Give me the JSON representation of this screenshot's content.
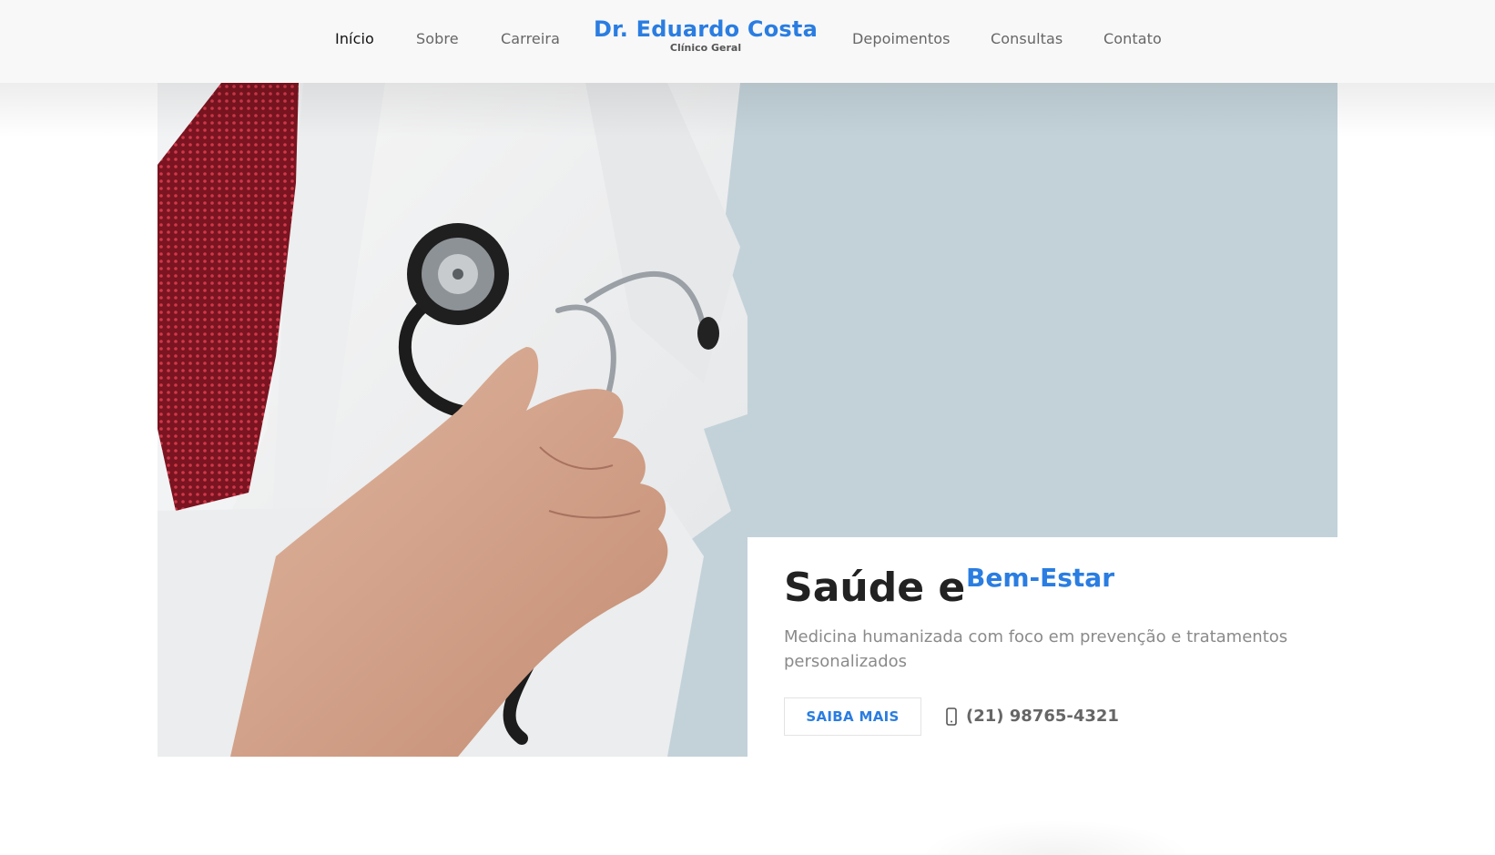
{
  "nav": {
    "items": [
      {
        "label": "Início",
        "active": true
      },
      {
        "label": "Sobre",
        "active": false
      },
      {
        "label": "Carreira",
        "active": false
      },
      {
        "label": "Depoimentos",
        "active": false
      },
      {
        "label": "Consultas",
        "active": false
      },
      {
        "label": "Contato",
        "active": false
      }
    ]
  },
  "logo": {
    "name": "Dr. Eduardo Costa",
    "subtitle": "Clínico Geral"
  },
  "hero": {
    "headline": "Saúde e",
    "headline_accent": "Bem-Estar",
    "subtitle": "Medicina humanizada com foco em prevenção e tratamentos personalizados",
    "cta_label": "SAIBA MAIS",
    "phone_icon": "mobile-phone-icon",
    "phone": "(21) 98765-4321"
  },
  "colors": {
    "accent": "#2a7de1",
    "hero_background": "#c3d2d9",
    "header_background": "#f8f8f8",
    "text_dark": "#222222",
    "text_muted": "#8a8a8a"
  }
}
